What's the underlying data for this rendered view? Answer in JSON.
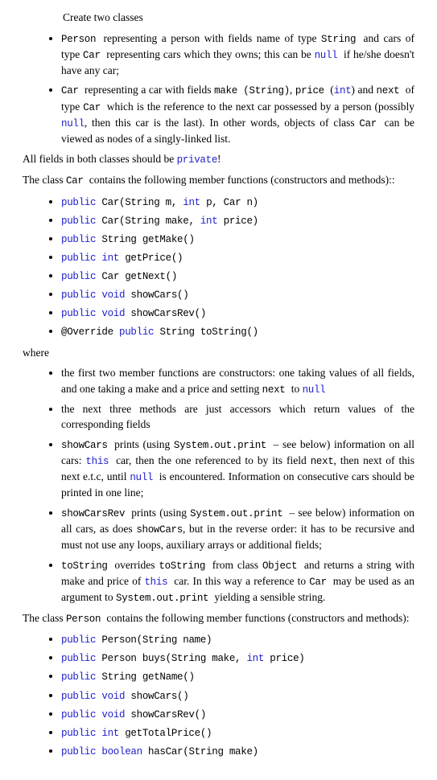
{
  "intro": "Create two classes",
  "bullets_top": [
    {
      "pre": "",
      "code1": "Person ",
      "mid1": "representing a person with fields name of type ",
      "code2": "String ",
      "mid2": "and cars of type ",
      "code3": "Car ",
      "mid3": "representing cars which they owns; this can be ",
      "kw1": "null ",
      "post": "if he/she doesn't have any car;"
    },
    {
      "pre": "",
      "code1": "Car ",
      "mid1": "representing a car with fields ",
      "code2": "make (String)",
      "mid2": ", ",
      "code3": "price ",
      "mid3": "(",
      "kw1": "int",
      "mid4": ") and ",
      "code4": "next ",
      "mid5": "of type ",
      "code5": "Car ",
      "mid6": "which is the reference to the next car possessed by a person (possibly ",
      "kw2": "null",
      "mid7": ", then this car is the last). In other words, objects of class ",
      "code6": "Car ",
      "post": "can be viewed as nodes of a singly-linked list."
    }
  ],
  "all_fields": {
    "pre": "All fields in both classes should be ",
    "kw": "private",
    "post": "!"
  },
  "class_car_intro": {
    "pre": "The class ",
    "code": "Car ",
    "post": "contains the following member functions (constructors and methods)::"
  },
  "car_methods": [
    {
      "kw": "public ",
      "sig": "Car(String m, ",
      "kw2": "int ",
      "sig2": "p, Car n)"
    },
    {
      "kw": "public ",
      "sig": "Car(String make, ",
      "kw2": "int ",
      "sig2": "price)"
    },
    {
      "kw": "public ",
      "sig": "String getMake()"
    },
    {
      "kw": "public int ",
      "sig": "getPrice()"
    },
    {
      "kw": "public ",
      "sig": "Car getNext()"
    },
    {
      "kw": "public void ",
      "sig": "showCars()"
    },
    {
      "kw": "public void ",
      "sig": "showCarsRev()"
    },
    {
      "pre": "@Override ",
      "kw": "public ",
      "sig": "String toString()"
    }
  ],
  "where": "where",
  "where_bullets": [
    {
      "pre": "the first two member functions are constructors: one taking values of all fields, and one taking a make and a price and setting ",
      "code1": "next ",
      "mid": "to ",
      "kw": "null"
    },
    {
      "pre": "the next three methods are just accessors which return values of the corresponding fields"
    },
    {
      "code1": "showCars ",
      "mid1": "prints (using ",
      "code2": "System.out.print ",
      "mid2": "– see below) information on all cars: ",
      "kw1": "this ",
      "mid3": "car, then the one referenced to by its field ",
      "code3": "next",
      "mid4": ", then next of this next e.t.c, until ",
      "kw2": "null ",
      "mid5": "is encountered. Information on consecutive cars should be printed in one line;"
    },
    {
      "code1": "showCarsRev ",
      "mid1": "prints (using ",
      "code2": "System.out.print ",
      "mid2": "– see below) information on all cars, as does ",
      "code3": "showCars",
      "mid3": ", but in the reverse order: it has to be recursive and must not use any loops, auxiliary arrays or additional fields;"
    },
    {
      "code1": "toString ",
      "mid1": "overrides ",
      "code2": "toString ",
      "mid2": "from class ",
      "code3": "Object ",
      "mid3": "and returns a string with make and price of ",
      "kw1": "this ",
      "mid4": "car. In this way a reference to ",
      "code4": "Car ",
      "mid5": "may be used as an argument to ",
      "code5": "System.out.print ",
      "mid6": "yielding a sensible string."
    }
  ],
  "class_person_intro": {
    "pre": "The class ",
    "code": "Person ",
    "post": "contains the following member functions (constructors and methods):"
  },
  "person_methods": [
    {
      "kw": "public ",
      "sig": "Person(String name)"
    },
    {
      "kw": "public ",
      "sig": "Person buys(String make, ",
      "kw2": "int ",
      "sig2": "price)"
    },
    {
      "kw": "public ",
      "sig": "String getName()"
    },
    {
      "kw": "public void ",
      "sig": "showCars()"
    },
    {
      "kw": "public void ",
      "sig": "showCarsRev()"
    },
    {
      "kw": "public int ",
      "sig": "getTotalPrice()"
    },
    {
      "kw": "public boolean ",
      "sig": "hasCar(String make)"
    }
  ]
}
